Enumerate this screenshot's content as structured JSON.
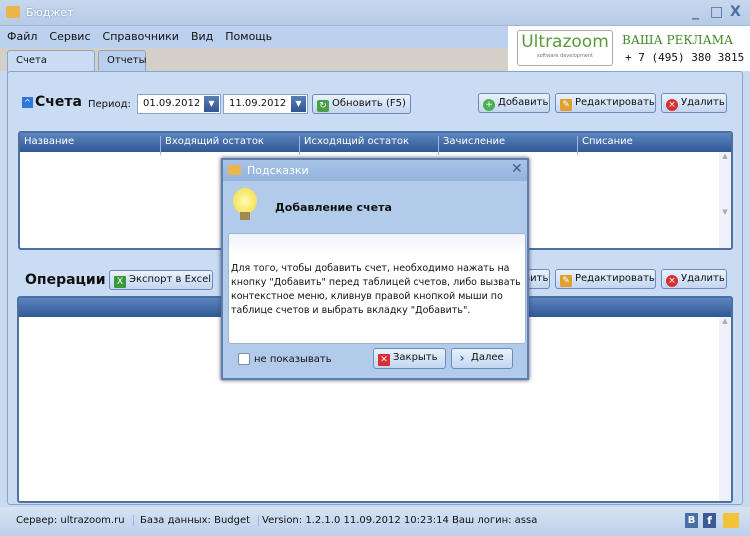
{
  "window": {
    "title": "Бюджет",
    "min": "_",
    "max": "□",
    "close": "X"
  },
  "menu": [
    "Файл",
    "Сервис",
    "Справочники",
    "Вид",
    "Помощь"
  ],
  "tabs": [
    "Счета",
    "Отчеты"
  ],
  "ad": {
    "logo": "Ultrazoom",
    "logo_sub": "software development",
    "headline": "ВАША РЕКЛАМА",
    "phone": "+ 7 (495) 380 3815"
  },
  "accounts": {
    "title": "Счета",
    "period_label": "Период:",
    "date_from": "01.09.2012",
    "date_to": "11.09.2012",
    "refresh": "Обновить (F5)",
    "add": "Добавить",
    "edit": "Редактировать",
    "delete": "Удалить",
    "columns": [
      "Название",
      "Входящий остаток",
      "Исходящий остаток",
      "Зачисление",
      "Списание"
    ]
  },
  "operations": {
    "title": "Операции",
    "export": "Экспорт в Excel",
    "add": "Добавить",
    "edit": "Редактировать",
    "delete": "Удалить"
  },
  "dialog": {
    "title": "Подсказки",
    "heading": "Добавление счета",
    "text": "Для того, чтобы добавить счет, необходимо нажать на кнопку \"Добавить\" перед таблицей счетов, либо вызвать контекстное меню, кливнув правой кнопкой мыши по таблице счетов и выбрать вкладку \"Добавить\".",
    "checkbox": "не показывать",
    "checked": false,
    "close": "Закрыть",
    "next": "Далее"
  },
  "status": {
    "server": "Сервер: ultrazoom.ru",
    "db": "База данных: Budget",
    "version": "Version: 1.2.1.0 11.09.2012 10:23:14",
    "login": "Ваш логин: assa",
    "vk": "B",
    "fb": "f"
  },
  "colors": {
    "header": "#2f5894",
    "panel": "#c9dcf3",
    "accent": "#3d6eb4"
  }
}
